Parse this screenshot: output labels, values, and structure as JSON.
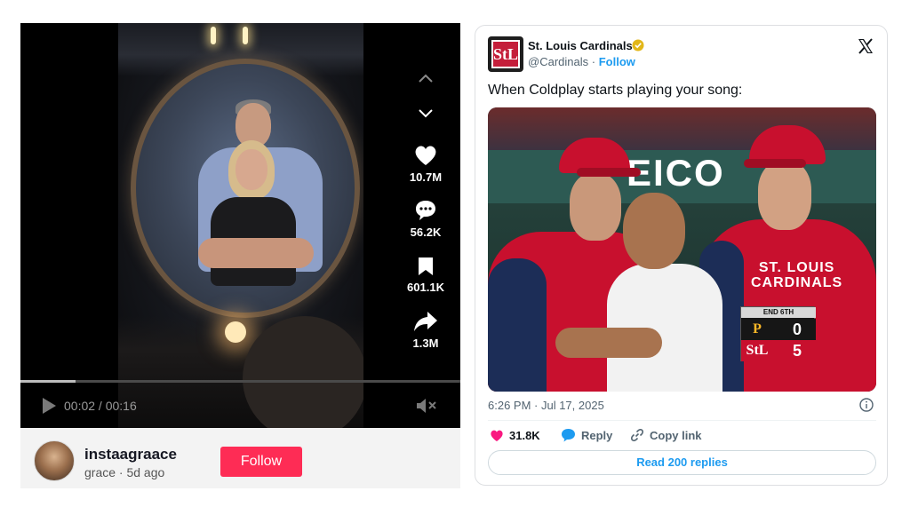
{
  "tiktok": {
    "side_actions": {
      "likes": "10.7M",
      "comments": "56.2K",
      "saves": "601.1K",
      "shares": "1.3M"
    },
    "player": {
      "time": "00:02 / 00:16",
      "progress": 0.125
    },
    "author": {
      "username": "instaagraace",
      "meta": "grace · 5d ago",
      "follow_label": "Follow"
    },
    "colors": {
      "follow_button": "#fe2c55"
    },
    "icons": [
      "chevron-up-icon",
      "chevron-down-icon",
      "heart-icon",
      "comment-icon",
      "bookmark-icon",
      "share-icon",
      "play-icon",
      "mute-icon"
    ]
  },
  "tweet": {
    "display_name": "St. Louis Cardinals",
    "logo_text": "StL",
    "handle": "@Cardinals",
    "separator": "·",
    "follow_label": "Follow",
    "text": "When Coldplay starts playing your song:",
    "media": {
      "board_text": "EICO",
      "jersey_text": "ST. LOUIS\nCARDINALS",
      "scoreboard": {
        "inning": "END 6TH",
        "rows": [
          {
            "logo": "P",
            "runs": "0",
            "logo_color": "#fdb827",
            "bg": "#161616"
          },
          {
            "logo": "StL",
            "runs": "5",
            "logo_color": "#ffffff",
            "bg": "#c8102e"
          }
        ]
      }
    },
    "timestamp": "6:26 PM · Jul 17, 2025",
    "actions": {
      "likes": "31.8K",
      "reply": "Reply",
      "copy_link": "Copy link"
    },
    "read_replies": "Read 200 replies",
    "colors": {
      "link": "#1d9bf0",
      "like": "#f91880",
      "verified": "#e2b719",
      "brand": "#c8102e"
    }
  }
}
